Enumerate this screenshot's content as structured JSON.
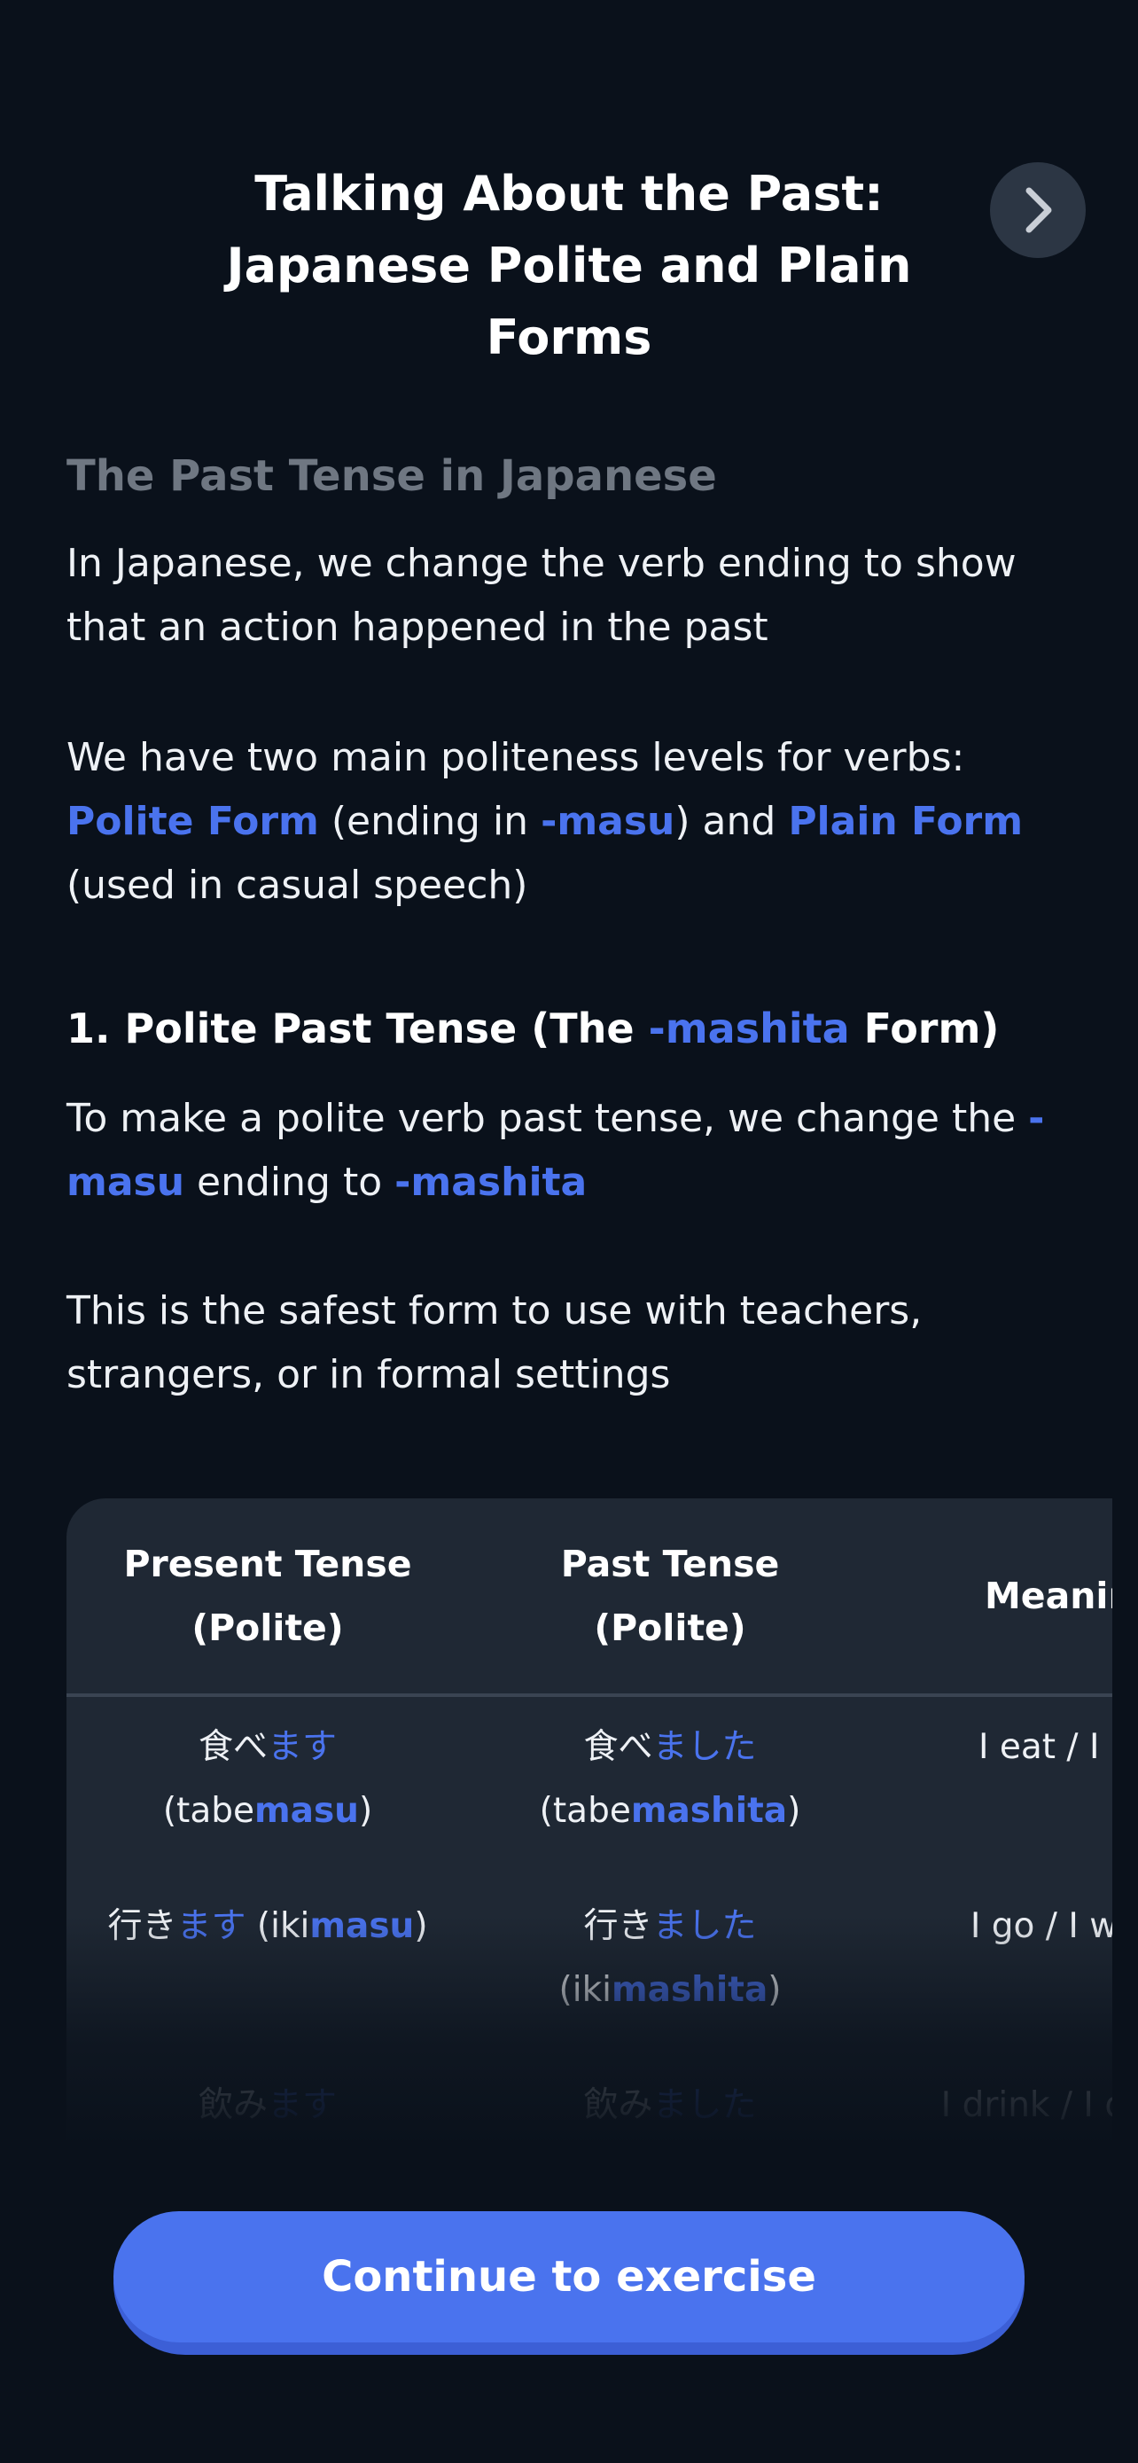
{
  "header": {
    "title_line1": "Talking About the Past:",
    "title_line2": "Japanese Polite and Plain",
    "title_line3": "Forms",
    "next_icon": "chevron-right-icon"
  },
  "lesson": {
    "section_title": "The Past Tense in Japanese",
    "intro": "In Japanese, we change the verb ending to show that an action happened in the past",
    "levels": {
      "pre": "We have two main politeness levels for verbs: ",
      "polite_form": "Polite Form",
      "mid1": " (ending in ",
      "masu": "-masu",
      "mid2": ") and ",
      "plain_form": "Plain Form",
      "post": " (used in casual speech)"
    },
    "polite_heading": {
      "pre": "1. Polite Past Tense (The ",
      "hl": "-mashita",
      "post": " Form)"
    },
    "polite_rule": {
      "pre": "To make a polite verb past tense, we change the ",
      "hl1": "-masu",
      "mid": " ending to ",
      "hl2": "-mashita"
    },
    "safest": "This is the safest form to use with teachers, strangers, or in formal settings"
  },
  "table": {
    "headers": {
      "present_line1": "Present Tense",
      "present_line2": "(Polite)",
      "past_line1": "Past Tense",
      "past_line2": "(Polite)",
      "meaning": "Meaning"
    },
    "rows": [
      {
        "present_stem": "食べ",
        "present_end": "ます",
        "present_rom_stem": "(tabe",
        "present_rom_end": "masu",
        "present_rom_close": ")",
        "past_stem": "食べ",
        "past_end": "ました",
        "past_rom_stem": "(tabe",
        "past_rom_end": "mashita",
        "past_rom_close": ")",
        "meaning": "I eat / I ate"
      },
      {
        "present_stem": "行き",
        "present_end": "ます",
        "present_rom_stem": " (iki",
        "present_rom_end": "masu",
        "present_rom_close": ")",
        "past_stem": "行き",
        "past_end": "ました",
        "past_rom_stem": "(iki",
        "past_rom_end": "mashita",
        "past_rom_close": ")",
        "meaning": "I go / I went"
      },
      {
        "present_stem": "飲み",
        "present_end": "ます",
        "past_stem": "飲み",
        "past_end": "ました",
        "meaning": "I drink / I drank"
      }
    ]
  },
  "footer": {
    "continue_label": "Continue to exercise"
  }
}
